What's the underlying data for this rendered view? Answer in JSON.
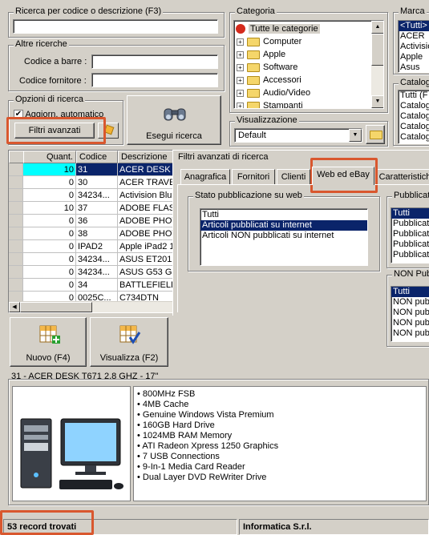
{
  "search": {
    "title": "Ricerca per codice o descrizione (F3)",
    "value": ""
  },
  "altre": {
    "title": "Altre ricerche",
    "barcode_label": "Codice a barre :",
    "barcode_value": "",
    "supplier_label": "Codice fornitore :",
    "supplier_value": ""
  },
  "opzioni": {
    "title": "Opzioni di ricerca",
    "auto_update_label": "Aggiorn. automatico",
    "auto_update_checked": true,
    "advanced_filters_label": "Filtri avanzati"
  },
  "search_button": {
    "label": "Esegui ricerca",
    "icon": "binoculars-icon"
  },
  "categoria": {
    "title": "Categoria",
    "items": [
      "Tutte le categorie",
      "Computer",
      "Apple",
      "Software",
      "Accessori",
      "Audio/Video",
      "Stampanti"
    ]
  },
  "marca": {
    "title": "Marca",
    "items": [
      "<Tutti>",
      "ACER",
      "Activision",
      "Apple",
      "Asus"
    ]
  },
  "cataloghi": {
    "title": "Catalog",
    "items": [
      "Tutti (F",
      "Catalog",
      "Catalog",
      "Catalog",
      "Catalog"
    ]
  },
  "visualizzazione": {
    "title": "Visualizzazione",
    "value": "Default"
  },
  "grid": {
    "columns": [
      "Quant.",
      "Codice",
      "Descrizione"
    ],
    "rows": [
      {
        "qty": "10",
        "code": "31",
        "desc": "ACER DESK T67"
      },
      {
        "qty": "0",
        "code": "30",
        "desc": "ACER TRAVELM"
      },
      {
        "qty": "0",
        "code": "34234...",
        "desc": "Activision Blur"
      },
      {
        "qty": "10",
        "code": "37",
        "desc": "ADOBE FLASH C"
      },
      {
        "qty": "0",
        "code": "36",
        "desc": "ADOBE PHOTOS"
      },
      {
        "qty": "0",
        "code": "38",
        "desc": "ADOBE PHOTOS"
      },
      {
        "qty": "0",
        "code": "IPAD2",
        "desc": "Apple iPad2 16"
      },
      {
        "qty": "0",
        "code": "34234...",
        "desc": "ASUS ET2012AU"
      },
      {
        "qty": "0",
        "code": "34234...",
        "desc": "ASUS G53 G53S"
      },
      {
        "qty": "0",
        "code": "34",
        "desc": "BATTLEFIELD 2"
      },
      {
        "qty": "0",
        "code": "0025C...",
        "desc": "C734DTN"
      }
    ]
  },
  "filters_panel": {
    "title": "Filtri avanzati di ricerca",
    "tabs": [
      "Anagrafica",
      "Fornitori",
      "Clienti",
      "Web ed eBay",
      "Caratteristich"
    ],
    "active_tab": "Web ed eBay",
    "stato": {
      "title": "Stato pubblicazione su web",
      "items": [
        "Tutti",
        "Articoli pubblicati su internet",
        "Articoli NON pubblicati su internet"
      ]
    },
    "pubblicato": {
      "title": "Pubblicato",
      "items": [
        "Tutti",
        "Pubblicato",
        "Pubblicato",
        "Pubblicato",
        "Pubblicato"
      ]
    },
    "non_pubblicato": {
      "title": "NON Pubbl",
      "items": [
        "Tutti",
        "NON pubbl",
        "NON pubbl",
        "NON pubbl",
        "NON pubbl"
      ]
    }
  },
  "actions": {
    "new_label": "Nuovo (F4)",
    "view_label": "Visualizza (F2)"
  },
  "product": {
    "title": "31 - ACER DESK T671 2,8 GHZ - 17\"",
    "specs": [
      "800MHz FSB",
      "4MB Cache",
      "Genuine Windows Vista Premium",
      "160GB Hard Drive",
      "1024MB RAM Memory",
      "ATI Radeon Xpress 1250 Graphics",
      "7 USB Connections",
      "9-In-1 Media Card Reader",
      "Dual Layer DVD ReWriter Drive"
    ]
  },
  "status": {
    "records": "53 record trovati",
    "company": "Informatica S.r.l."
  },
  "colors": {
    "highlight_red": "#d9572e",
    "selection_blue": "#0a246a",
    "row_selected_cyan": "#00ffff"
  }
}
